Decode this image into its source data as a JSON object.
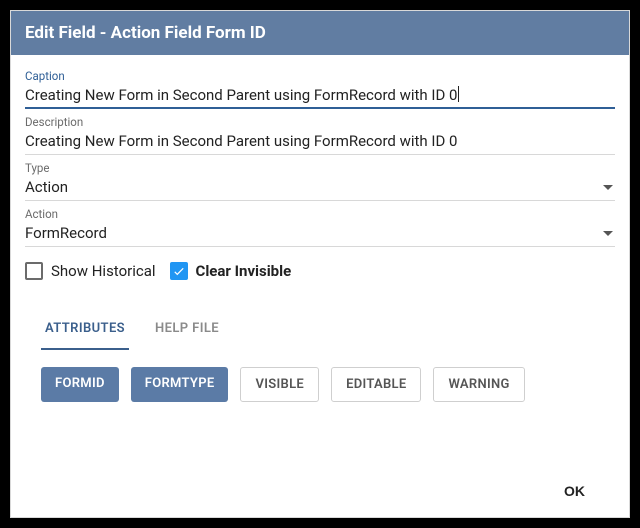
{
  "header": {
    "title": "Edit Field - Action Field Form ID"
  },
  "fields": {
    "caption": {
      "label": "Caption",
      "value": "Creating New Form in Second Parent using FormRecord with ID 0"
    },
    "description": {
      "label": "Description",
      "value": "Creating New Form in Second Parent using FormRecord with ID 0"
    },
    "type": {
      "label": "Type",
      "value": "Action"
    },
    "action": {
      "label": "Action",
      "value": "FormRecord"
    }
  },
  "checks": {
    "show_historical": {
      "label": "Show Historical",
      "checked": false
    },
    "clear_invisible": {
      "label": "Clear Invisible",
      "checked": true
    }
  },
  "tabs": {
    "attributes": "ATTRIBUTES",
    "help_file": "HELP FILE"
  },
  "chips": {
    "formid": "FORMID",
    "formtype": "FORMTYPE",
    "visible": "VISIBLE",
    "editable": "EDITABLE",
    "warning": "WARNING"
  },
  "footer": {
    "ok": "OK"
  }
}
